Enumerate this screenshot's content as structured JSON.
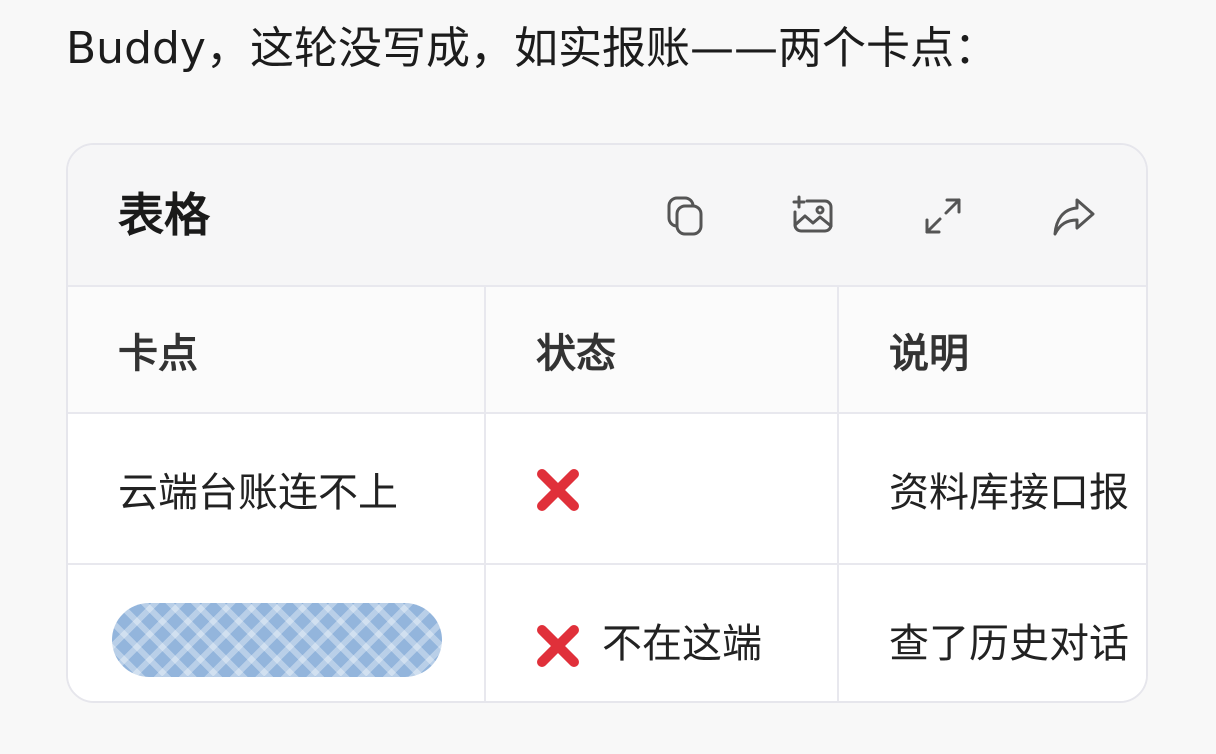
{
  "message": {
    "intro": "Buddy，这轮没写成，如实报账——两个卡点："
  },
  "card": {
    "title": "表格",
    "toolbar": {
      "copy_icon": "copy-icon",
      "image_icon": "image-icon",
      "expand_icon": "expand-icon",
      "share_icon": "share-icon"
    },
    "table": {
      "headers": [
        "卡点",
        "状态",
        "说明"
      ],
      "rows": [
        {
          "blocker": "云端台账连不上",
          "status_icon": "cross-mark-icon",
          "status_text": "",
          "note": "资料库接口报"
        },
        {
          "blocker": "",
          "blocker_redacted": true,
          "status_icon": "cross-mark-icon",
          "status_text": "不在这端",
          "note": "查了历史对话"
        }
      ]
    }
  },
  "colors": {
    "background": "#f8f8f8",
    "card_border": "#e6e6ec",
    "header_bg": "#f6f6f7",
    "cross_red": "#e0303a",
    "redaction_blue": "#93b5dc"
  }
}
